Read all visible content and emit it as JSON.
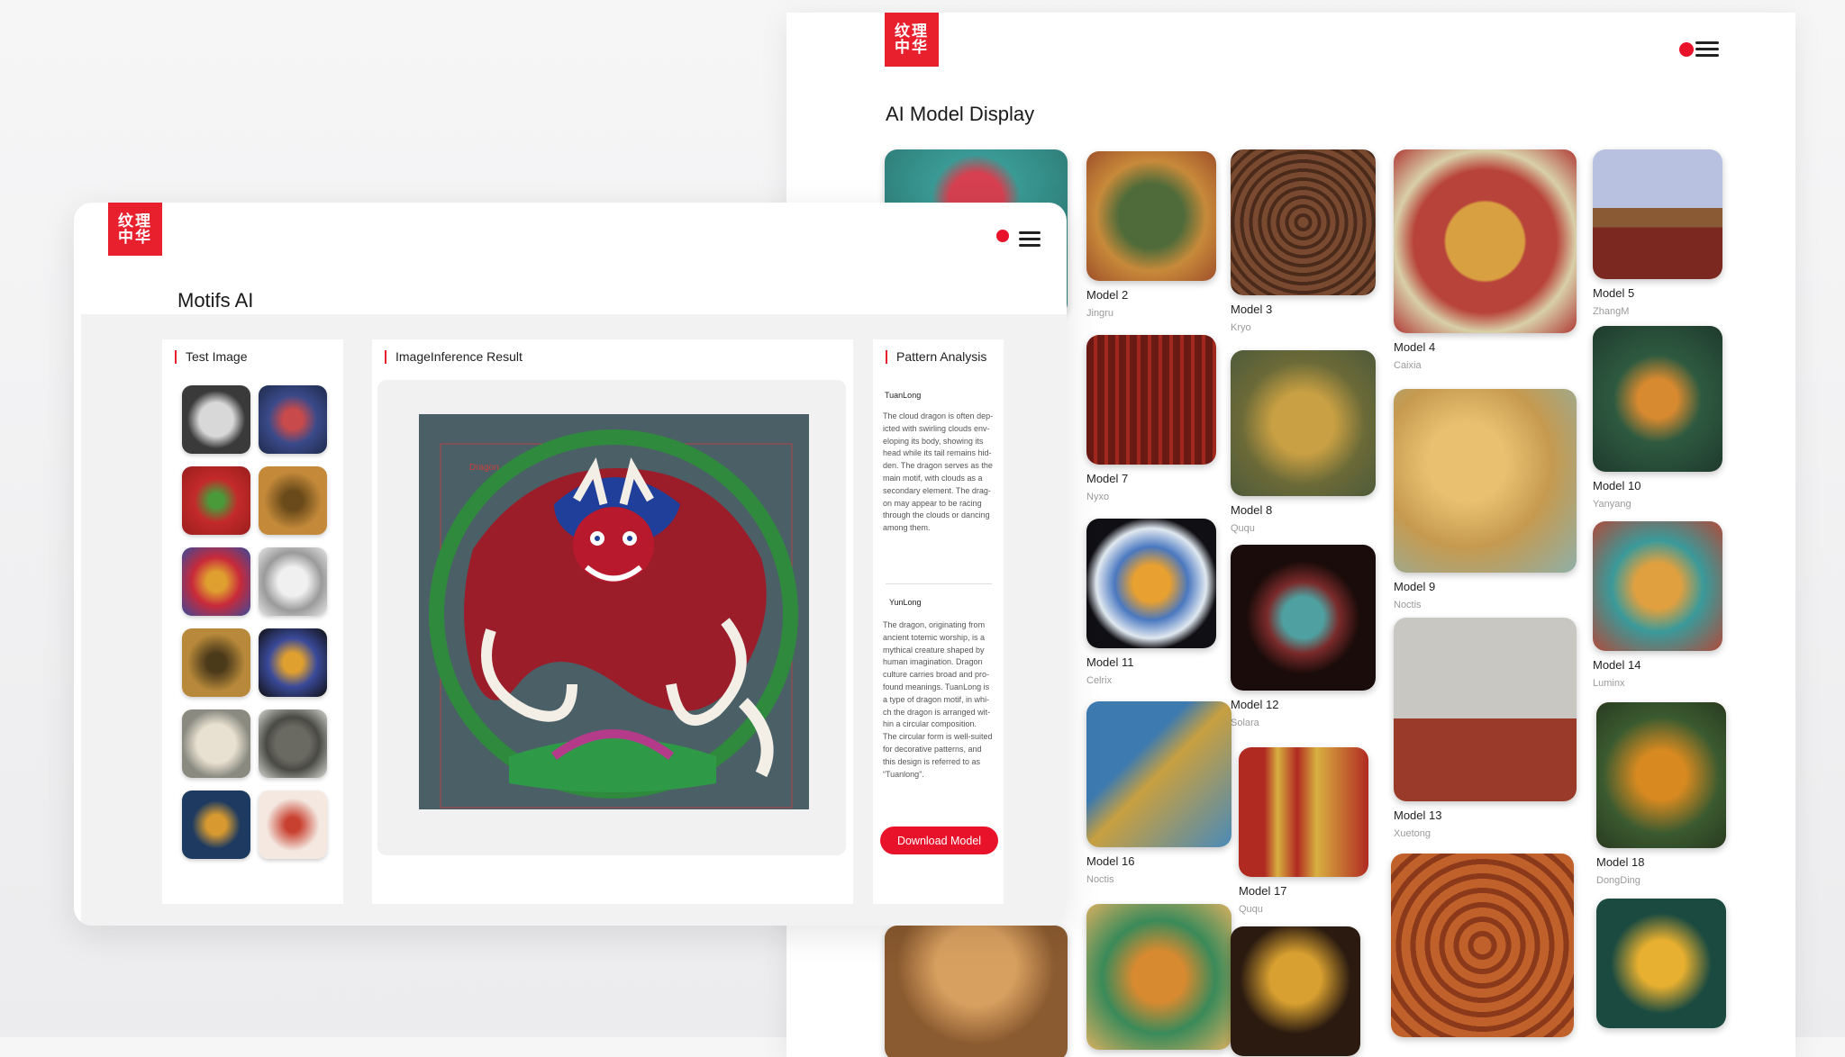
{
  "colors": {
    "accent": "#e8132a",
    "logo": "#e8202e",
    "background": "#f2f2f3"
  },
  "back_window": {
    "logo_text": "纹理中华",
    "title": "AI Model Display",
    "icons": {
      "status": "red-dot-icon",
      "menu": "hamburger-menu-icon"
    },
    "models": [
      {
        "name": "",
        "author": ""
      },
      {
        "name": "Model 2",
        "author": "Jingru"
      },
      {
        "name": "Model 3",
        "author": "Kryo"
      },
      {
        "name": "Model 4",
        "author": "Caixia"
      },
      {
        "name": "Model 5",
        "author": "ZhangM"
      },
      {
        "name": "Model 7",
        "author": "Nyxo"
      },
      {
        "name": "Model 8",
        "author": "Ququ"
      },
      {
        "name": "Model 9",
        "author": "Noctis"
      },
      {
        "name": "Model 10",
        "author": "Yanyang"
      },
      {
        "name": "Model 11",
        "author": "Celrix"
      },
      {
        "name": "Model 12",
        "author": "Solara"
      },
      {
        "name": "Model 13",
        "author": "Xuetong"
      },
      {
        "name": "Model 14",
        "author": "Luminx"
      },
      {
        "name": "Model 16",
        "author": "Noctis"
      },
      {
        "name": "Model 17",
        "author": "Ququ"
      },
      {
        "name": "Model 18",
        "author": "DongDing"
      },
      {
        "name": "",
        "author": ""
      },
      {
        "name": "",
        "author": ""
      },
      {
        "name": "",
        "author": ""
      },
      {
        "name": "",
        "author": ""
      },
      {
        "name": "",
        "author": ""
      }
    ]
  },
  "front_window": {
    "logo_text": "纹理中华",
    "title": "Motifs AI",
    "test_image": {
      "title": "Test Image",
      "thumbnails": [
        "white-dragon-roundel",
        "blue-dragon-roundel",
        "red-dragon-tile",
        "gold-dragon-roundel",
        "red-gold-dragon-roundel",
        "silver-dragon-roundel",
        "ochre-dragon-tile",
        "navy-dragon-roundel",
        "ivory-dragon-disc",
        "bronze-coin-disc",
        "navy-gold-dragon-disc",
        "red-line-dragon-disc"
      ]
    },
    "result": {
      "title": "ImageInference Result",
      "label": "Dragon"
    },
    "analysis": {
      "title": "Pattern Analysis",
      "sections": [
        {
          "label": "TuanLong",
          "lines": [
            "The cloud dragon is often dep-",
            "icted with swirling clouds env-",
            "eloping its body, showing its",
            "head while its tail remains hid-",
            "den. The dragon serves as the",
            "main motif, with clouds as a",
            "secondary element. The drag-",
            "on may appear to be racing",
            "through the clouds or dancing",
            "among them."
          ]
        },
        {
          "label": "YunLong",
          "lines": [
            "The dragon, originating from",
            "ancient totemic worship, is a",
            "mythical creature shaped by",
            "human imagination. Dragon",
            "culture carries broad and pro-",
            "found meanings. TuanLong is",
            "a type of dragon motif, in whi-",
            "ch the dragon is arranged wit-",
            "hin a circular composition.",
            "The circular form is well-suited",
            "for decorative patterns, and",
            "this design is referred to as",
            "“Tuanlong”."
          ]
        }
      ],
      "download_label": "Download Model"
    },
    "icons": {
      "status": "red-dot-icon",
      "menu": "hamburger-menu-icon"
    }
  }
}
